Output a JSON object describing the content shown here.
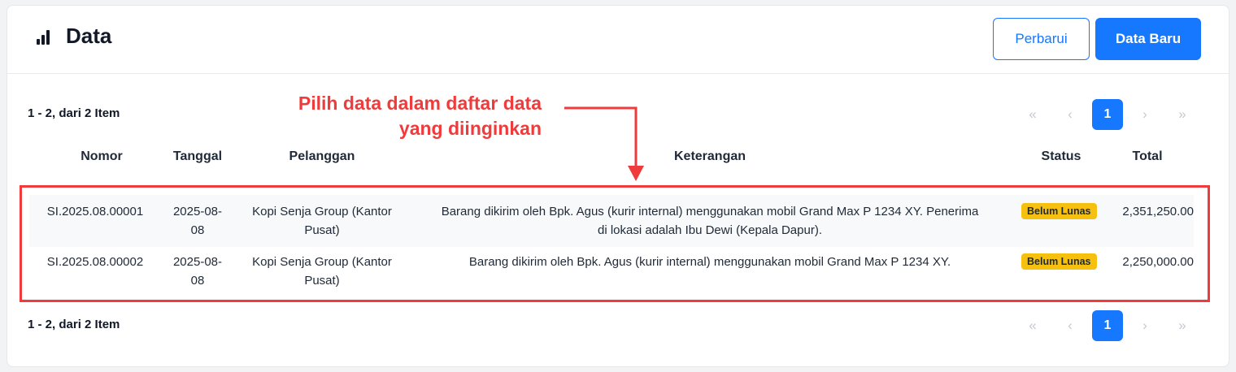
{
  "header": {
    "title": "Data",
    "icon": "bar-chart-icon",
    "refresh_label": "Perbarui",
    "new_label": "Data Baru"
  },
  "pagination": {
    "count_label": "1 - 2, dari 2 Item",
    "first": "«",
    "prev": "‹",
    "current": "1",
    "next": "›",
    "last": "»"
  },
  "annotation": {
    "text_line1": "Pilih data dalam daftar data",
    "text_line2": "yang diinginkan",
    "color": "#ef3b3b"
  },
  "table": {
    "columns": [
      "Nomor",
      "Tanggal",
      "Pelanggan",
      "Keterangan",
      "Status",
      "Total"
    ],
    "rows": [
      {
        "nomor": "SI.2025.08.00001",
        "tanggal_1": "2025-08-",
        "tanggal_2": "08",
        "pelanggan_1": "Kopi Senja Group (Kantor",
        "pelanggan_2": "Pusat)",
        "keterangan_1": "Barang dikirim oleh Bpk. Agus (kurir internal) menggunakan mobil Grand Max P 1234 XY. Penerima",
        "keterangan_2": "di lokasi adalah Ibu Dewi (Kepala Dapur).",
        "status": "Belum Lunas",
        "total": "2,351,250.00"
      },
      {
        "nomor": "SI.2025.08.00002",
        "tanggal_1": "2025-08-",
        "tanggal_2": "08",
        "pelanggan_1": "Kopi Senja Group (Kantor",
        "pelanggan_2": "Pusat)",
        "keterangan_1": "Barang dikirim oleh Bpk. Agus (kurir internal) menggunakan mobil Grand Max P 1234 XY.",
        "keterangan_2": "",
        "status": "Belum Lunas",
        "total": "2,250,000.00"
      }
    ]
  },
  "colors": {
    "primary": "#1677ff",
    "badge": "#f6c10e",
    "annotation": "#ef3b3b"
  }
}
